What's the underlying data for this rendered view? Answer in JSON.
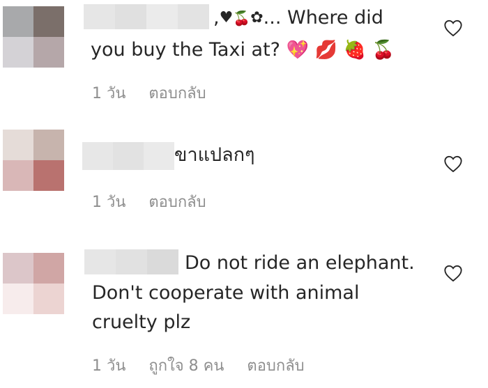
{
  "comments": [
    {
      "avatar_colors": [
        "#a8a9ab",
        "#7b6f6a",
        "#d4d2d6",
        "#b5a7a9"
      ],
      "name_blur_colors": [
        "#e6e6e6",
        "#e0e0e0",
        "#ebebeb",
        "#e3e3e3"
      ],
      "text_prefix": ",",
      "text_suffix": "... Where did",
      "line2": "you buy the Taxi at?",
      "emoji_line1": [
        "♥",
        "🍒",
        "✿"
      ],
      "emoji_line2": [
        "💖",
        "💋",
        "🍓",
        "🍒"
      ],
      "time": "1 วัน",
      "reply": "ตอบกลับ"
    },
    {
      "avatar_colors": [
        "#e5dcd8",
        "#c7b4ad",
        "#d9b7b7",
        "#b9726f"
      ],
      "name_blur_colors": [
        "#e7e7e7",
        "#e2e2e2",
        "#eaeaea"
      ],
      "text": "ขาแปลกๆ",
      "time": "1 วัน",
      "reply": "ตอบกลับ"
    },
    {
      "avatar_colors": [
        "#dcc6c9",
        "#d0a6a5",
        "#f7ecec",
        "#ecd4d2"
      ],
      "name_blur_colors": [
        "#e6e6e6",
        "#e1e1e1",
        "#dadada"
      ],
      "line1": "Do not ride an elephant.",
      "line2": "Don't cooperate with animal",
      "line3": "cruelty plz",
      "time": "1 วัน",
      "likes": "ถูกใจ 8 คน",
      "reply": "ตอบกลับ"
    }
  ]
}
